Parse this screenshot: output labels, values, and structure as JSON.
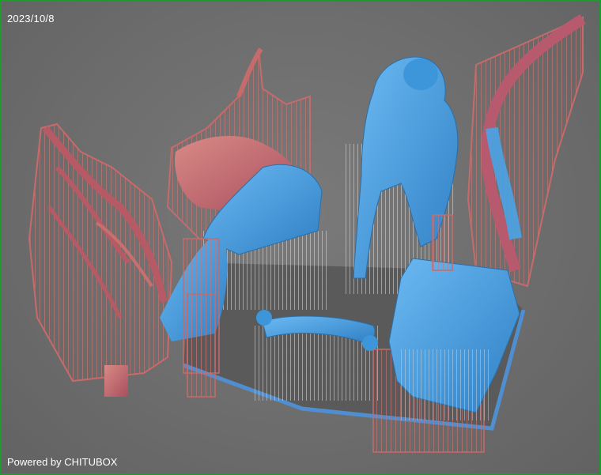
{
  "viewport": {
    "date": "2023/10/8",
    "footer": "Powered by CHITUBOX"
  },
  "colors": {
    "frame": "#1f9a2e",
    "background": "#6e6e6e",
    "model_blue": "#4aa3e6",
    "model_red": "#c46a68",
    "supports_grey": "#c9c9c9",
    "build_plate_outline": "#4f8fd1"
  },
  "icons": {
    "scene": "3d-print-models-with-supports"
  }
}
